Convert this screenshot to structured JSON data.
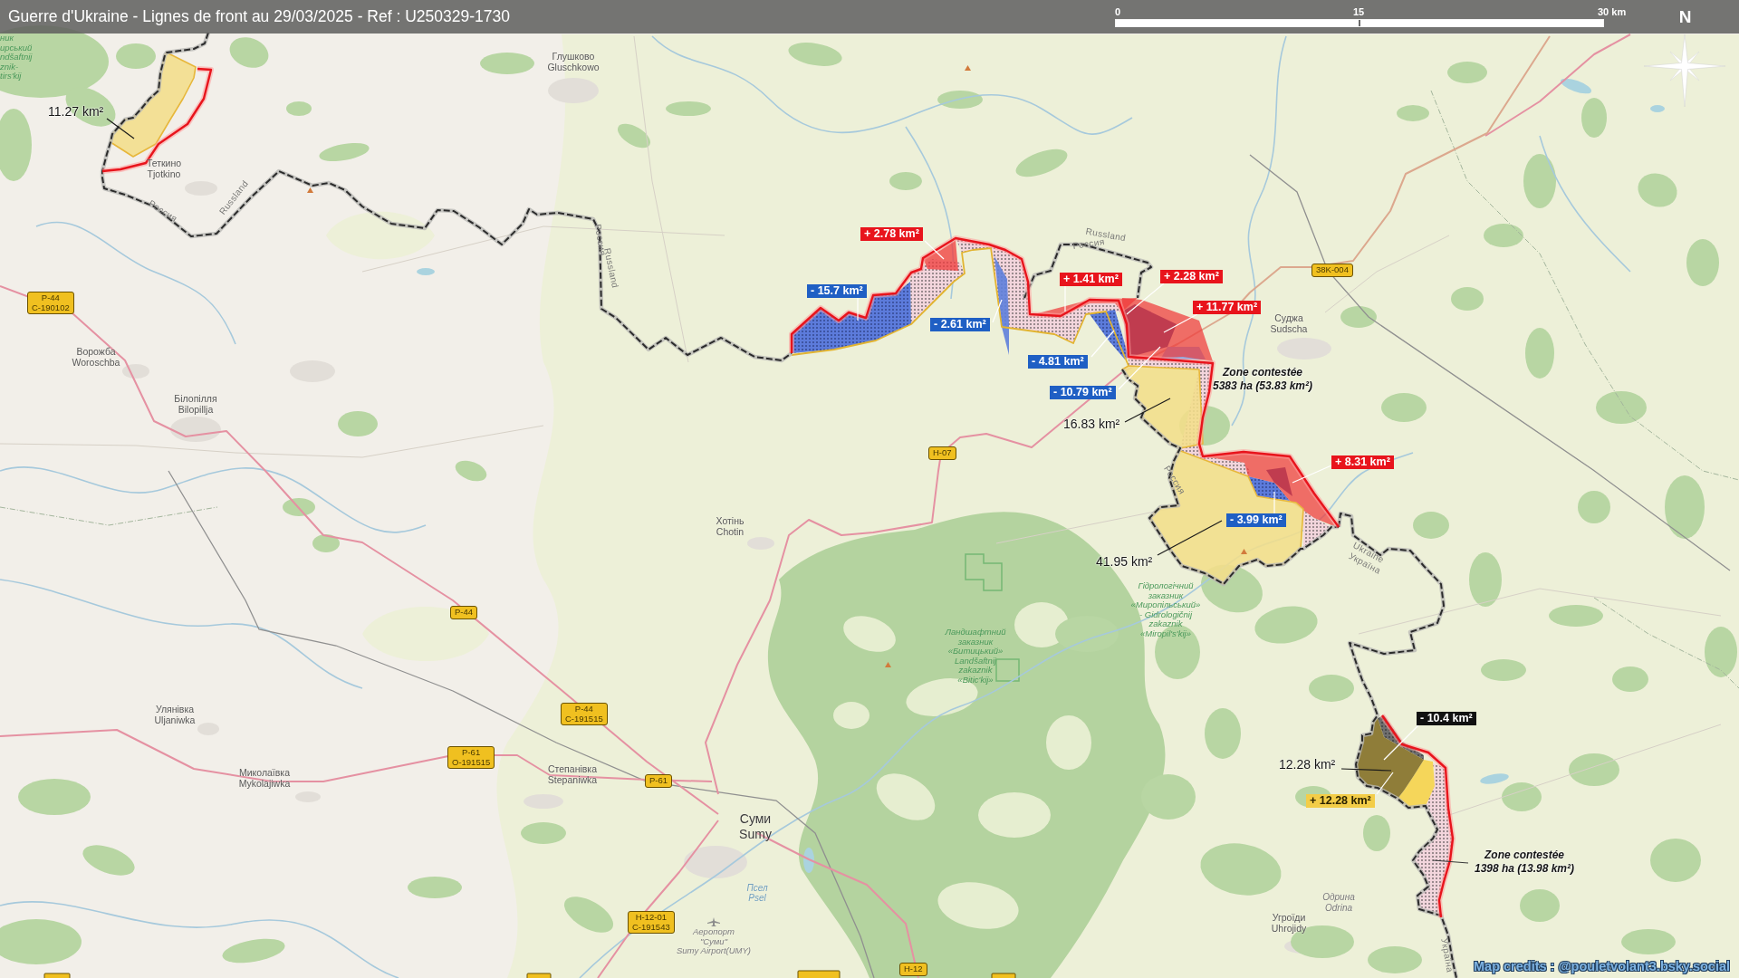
{
  "title_bar": {
    "title": "Guerre d'Ukraine - Lignes de front au 29/03/2025 - Ref : U250329-1730",
    "scale_ticks": [
      "0",
      "15",
      "30 km"
    ],
    "north": "N"
  },
  "area_labels": [
    {
      "text": "11.27 km²",
      "kind": "plain"
    },
    {
      "text": "+ 2.78 km²",
      "kind": "tag",
      "color": "#e8141c"
    },
    {
      "text": "+ 2.28 km²",
      "kind": "tag",
      "color": "#e8141c"
    },
    {
      "text": "+ 1.41 km²",
      "kind": "tag",
      "color": "#e8141c"
    },
    {
      "text": "- 15.7 km²",
      "kind": "tag",
      "color": "#1f5fc4"
    },
    {
      "text": "+ 11.77 km²",
      "kind": "tag",
      "color": "#e8141c"
    },
    {
      "text": "- 2.61 km²",
      "kind": "tag",
      "color": "#1f5fc4"
    },
    {
      "text": "- 4.81 km²",
      "kind": "tag",
      "color": "#1f5fc4"
    },
    {
      "text": "- 10.79 km²",
      "kind": "tag",
      "color": "#1f5fc4"
    },
    {
      "text": "16.83 km²",
      "kind": "plain"
    },
    {
      "text": "+ 8.31 km²",
      "kind": "tag",
      "color": "#e8141c"
    },
    {
      "text": "- 3.99 km²",
      "kind": "tag",
      "color": "#1f5fc4"
    },
    {
      "text": "41.95 km²",
      "kind": "plain"
    },
    {
      "text": "- 10.4 km²",
      "kind": "tag",
      "color": "#111111"
    },
    {
      "text": "12.28 km²",
      "kind": "plain"
    },
    {
      "text": "+ 12.28 km²",
      "kind": "tag",
      "color": "#f3cd48"
    }
  ],
  "zone_notes": [
    {
      "lines": [
        "Zone contestée",
        "5383 ha (53.83 km²)"
      ]
    },
    {
      "lines": [
        "Zone contestée",
        "1398 ha (13.98 km²)"
      ]
    }
  ],
  "places": [
    {
      "kind": "town",
      "lines": [
        "Глушково",
        "Gluschkowo"
      ]
    },
    {
      "kind": "town",
      "lines": [
        "Теткино",
        "Tjotkino"
      ]
    },
    {
      "kind": "town",
      "lines": [
        "Суджа",
        "Sudscha"
      ]
    },
    {
      "kind": "town",
      "lines": [
        "Ворожба",
        "Woroschba"
      ]
    },
    {
      "kind": "town",
      "lines": [
        "Білопілля",
        "Bilopillja"
      ]
    },
    {
      "kind": "town",
      "lines": [
        "Хотінь",
        "Chotin"
      ]
    },
    {
      "kind": "town",
      "lines": [
        "Улянівка",
        "Uljaniwka"
      ]
    },
    {
      "kind": "town",
      "lines": [
        "Миколаївка",
        "Mykolajiwka"
      ]
    },
    {
      "kind": "town",
      "lines": [
        "Степанівка",
        "Stepaniwka"
      ]
    },
    {
      "kind": "city",
      "lines": [
        "Суми",
        "Sumy"
      ]
    },
    {
      "kind": "river",
      "lines": [
        "Псел",
        "Psel"
      ]
    },
    {
      "kind": "locality",
      "lines": [
        "Одрина",
        "Odrina"
      ]
    },
    {
      "kind": "town",
      "lines": [
        "Угроїди",
        "Uhrojidy"
      ]
    },
    {
      "kind": "airport",
      "lines": [
        "Аеропорт",
        "\"Суми\"",
        "Sumy Airport(UMY)"
      ]
    }
  ],
  "road_shields": [
    {
      "lines": [
        "38K-004"
      ]
    },
    {
      "lines": [
        "P-44",
        "C-190102"
      ]
    },
    {
      "lines": [
        "H-07"
      ]
    },
    {
      "lines": [
        "P-44"
      ]
    },
    {
      "lines": [
        "P-44",
        "C-191515"
      ]
    },
    {
      "lines": [
        "P-61",
        "O-191515"
      ]
    },
    {
      "lines": [
        "P-61"
      ]
    },
    {
      "lines": [
        "H-12-01",
        "C-191543"
      ]
    },
    {
      "lines": [
        "H-12"
      ]
    }
  ],
  "country_labels": [
    "Russland",
    "Россия",
    "Россия",
    "Russland",
    "Russland",
    "Россия",
    "Россия",
    "Ukraine",
    "Україна",
    "Україна"
  ],
  "reserve_labels": [
    {
      "lines": [
        "ник",
        "ирський",
        "ndšaftnij",
        "znik-",
        "tirs'kij"
      ]
    },
    {
      "lines": [
        "Гідрологічний",
        "заказник",
        "«Миропільський»",
        "- Gidrologičnij",
        "zakaznik",
        "«Miropil's'kij»"
      ]
    },
    {
      "lines": [
        "Ландшафтний",
        "заказник",
        "«Битицький»",
        "Landšaftnij",
        "zakaznik",
        "«Bitic'kij»"
      ]
    }
  ],
  "credits": "Map credits : @pouletvolant3.bsky.social"
}
